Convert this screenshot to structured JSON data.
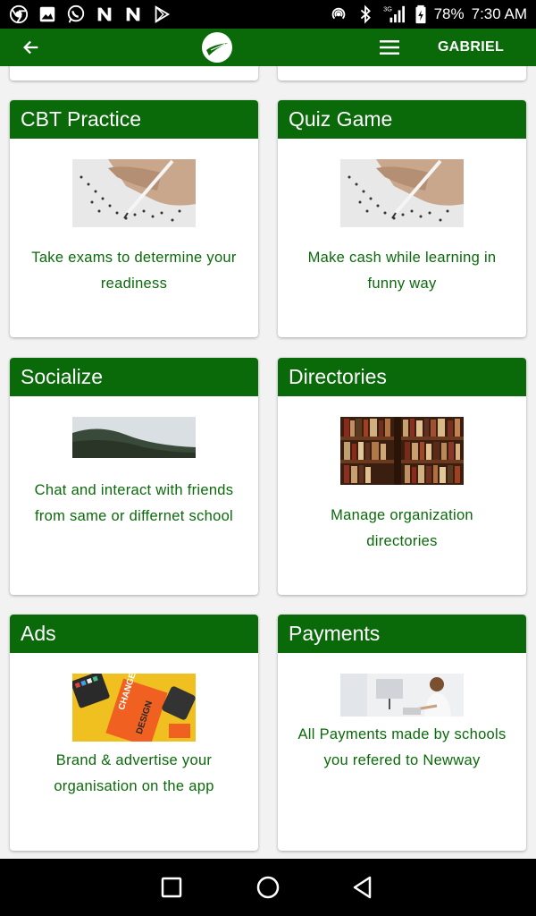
{
  "status_bar": {
    "battery": "78%",
    "time": "7:30 AM",
    "network": "3G",
    "left_icons": [
      "chrome-icon",
      "gallery-icon",
      "whatsapp-icon",
      "n-app-icon",
      "n-app-icon",
      "play-store-icon"
    ]
  },
  "app_bar": {
    "user_name": "GABRIEL"
  },
  "cards": [
    {
      "title": "CBT Practice",
      "description": "Take exams to determine your readiness",
      "image": "exam-paper-image"
    },
    {
      "title": "Quiz Game",
      "description": "Make cash while learning in funny way",
      "image": "exam-paper-image"
    },
    {
      "title": "Socialize",
      "description": "Chat and interact with friends from same or differnet school",
      "image": "hill-landscape-image"
    },
    {
      "title": "Directories",
      "description": "Manage organization directories",
      "image": "bookshelf-image"
    },
    {
      "title": "Ads",
      "description": "Brand & advertise your organisation on the app",
      "image": "design-book-image"
    },
    {
      "title": "Payments",
      "description": "All Payments made by schools you refered to Newway",
      "image": "office-worker-image"
    }
  ],
  "colors": {
    "primary": "#0a6a0a",
    "background": "#f2f2f2"
  }
}
